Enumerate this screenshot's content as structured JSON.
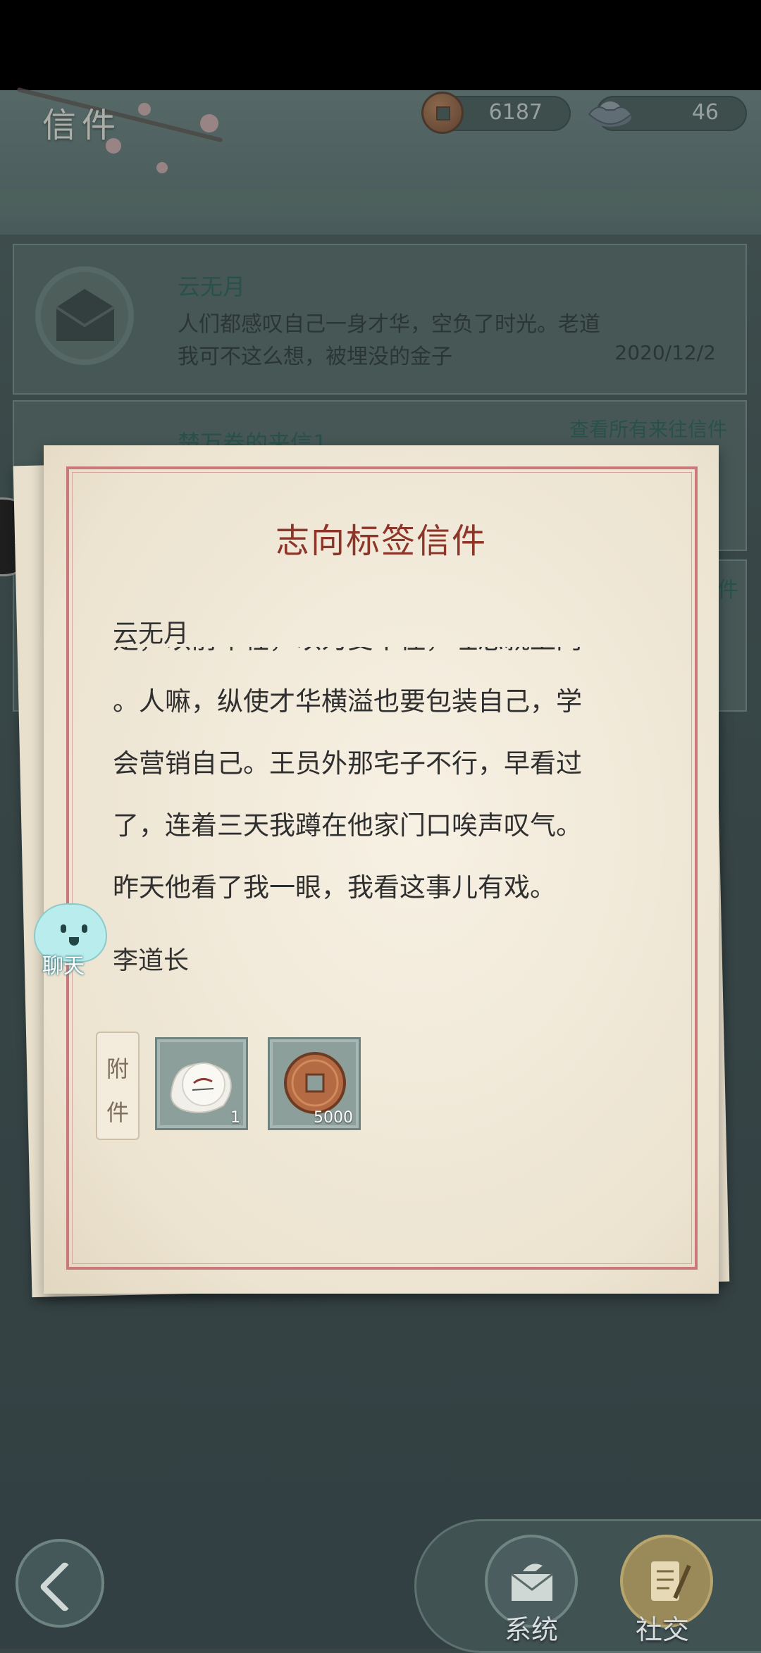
{
  "header": {
    "title": "信件"
  },
  "currencies": [
    {
      "name": "coin-icon",
      "value": "6187"
    },
    {
      "name": "ingot-icon",
      "value": "46"
    }
  ],
  "list": {
    "items": [
      {
        "sender": "云无月",
        "preview": "人们都感叹自己一身才华，空负了时光。老道我可不这么想，被埋没的金子",
        "date": "2020/12/2"
      },
      {
        "sender": "楚万卷的来信1"
      }
    ],
    "view_all": "查看所有来往信件",
    "partial_right_text": "件"
  },
  "letter": {
    "title": "志向标签信件",
    "greeting": "云无月",
    "body_lines": [
      "是，以前年轻，以为受不住，埋怨就上门",
      "。人嘛，纵使才华横溢也要包装自己，学",
      "会营销自己。王员外那宅子不行，早看过",
      "了，连着三天我蹲在他家门口唉声叹气。",
      "昨天他看了我一眼，我看这事儿有戏。"
    ],
    "signature": "李道长",
    "attachment_label_1": "附",
    "attachment_label_2": "件",
    "attachments": [
      {
        "icon": "tea-cake-icon",
        "count": "1"
      },
      {
        "icon": "copper-coin-icon",
        "count": "5000"
      }
    ]
  },
  "chat": {
    "label": "聊天"
  },
  "bottom_nav": {
    "system": "系统",
    "social": "社交"
  }
}
